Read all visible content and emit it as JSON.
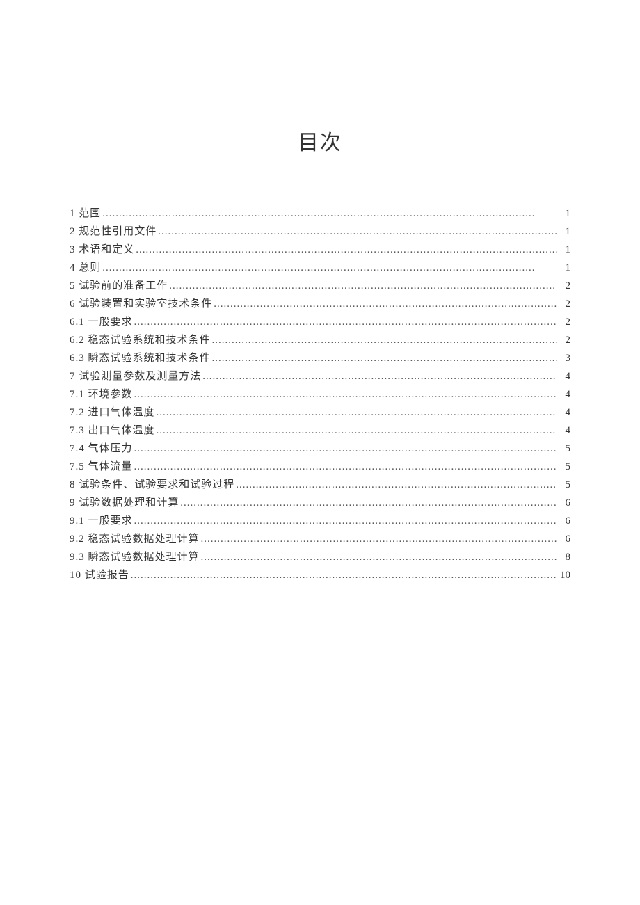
{
  "title": "目次",
  "toc": [
    {
      "label": "1 范围",
      "page": "1"
    },
    {
      "label": "2 规范性引用文件",
      "page": "1"
    },
    {
      "label": "3 术语和定义",
      "page": "1"
    },
    {
      "label": "4 总则",
      "page": "1"
    },
    {
      "label": "5 试验前的准备工作",
      "page": "2"
    },
    {
      "label": "6 试验装置和实验室技术条件",
      "page": "2"
    },
    {
      "label": "6.1  一般要求",
      "page": "2"
    },
    {
      "label": "6.2  稳态试验系统和技术条件",
      "page": "2"
    },
    {
      "label": "6.3  瞬态试验系统和技术条件",
      "page": "3"
    },
    {
      "label": "7 试验测量参数及测量方法",
      "page": "4"
    },
    {
      "label": "7.1  环境参数",
      "page": "4"
    },
    {
      "label": "7.2  进口气体温度",
      "page": "4"
    },
    {
      "label": "7.3  出口气体温度",
      "page": "4"
    },
    {
      "label": "7.4  气体压力",
      "page": "5"
    },
    {
      "label": "7.5  气体流量",
      "page": "5"
    },
    {
      "label": "8 试验条件、试验要求和试验过程",
      "page": "5"
    },
    {
      "label": "9 试验数据处理和计算",
      "page": "6"
    },
    {
      "label": "9.1  一般要求",
      "page": "6"
    },
    {
      "label": "9.2  稳态试验数据处理计算",
      "page": "6"
    },
    {
      "label": "9.3  瞬态试验数据处理计算",
      "page": "8"
    },
    {
      "label": "10 试验报告",
      "page": "10"
    }
  ]
}
